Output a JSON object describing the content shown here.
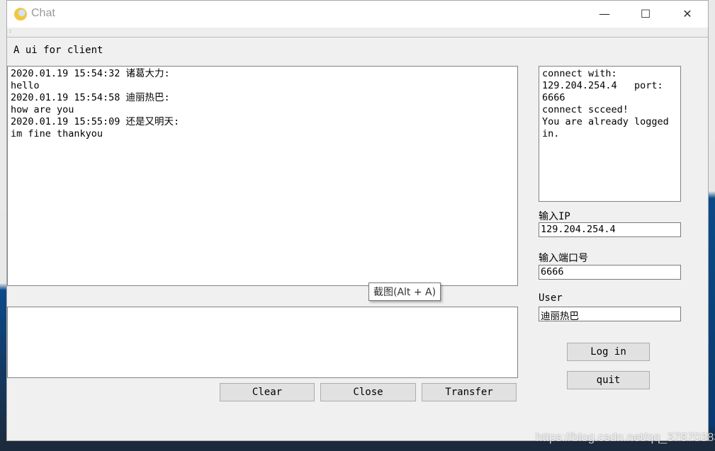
{
  "window": {
    "title": "Chat",
    "app_icon": "rocket-icon",
    "minimize": "—",
    "maximize": "☐",
    "close": "✕"
  },
  "menustrip": ":",
  "heading": "A ui for client",
  "chat_log": "2020.01.19 15:54:32 诸葛大力:\nhello\n2020.01.19 15:54:58 迪丽热巴:\nhow are you\n2020.01.19 15:55:09 还是又明天:\nim fine thankyou",
  "message_input": "",
  "status_log": "connect with:\n129.204.254.4   port:\n6666\nconnect scceed!\nYou are already logged\nin.",
  "ip": {
    "label": "输入IP",
    "value": "129.204.254.4"
  },
  "port": {
    "label": "输入端口号",
    "value": "6666"
  },
  "user": {
    "label": "User",
    "value": "迪丽热巴"
  },
  "buttons": {
    "login": "Log in",
    "quit": "quit",
    "clear": "Clear",
    "close": "Close",
    "transfer": "Transfer"
  },
  "tooltip": "截图(Alt + A)",
  "watermark": "https://blog.csdn.net/qq_37870383"
}
